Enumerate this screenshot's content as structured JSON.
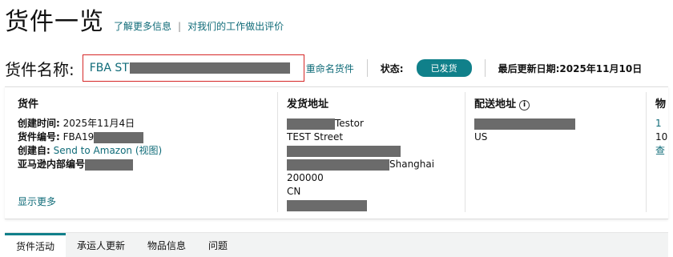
{
  "header": {
    "title": "货件一览",
    "link_learn": "了解更多信息",
    "separator": "|",
    "link_feedback": "对我们的工作做出评价"
  },
  "shipment": {
    "name_label": "货件名称:",
    "name_value": "FBA ST",
    "rename": "重命名货件",
    "status_label": "状态:",
    "status_value": "已发货",
    "updated_label": "最后更新日期:",
    "updated_value": "2025年11月10日"
  },
  "details": {
    "title": "货件",
    "created_label": "创建时间:",
    "created_value": "2025年11月4日",
    "number_label": "货件编号:",
    "number_value": "FBA19",
    "source_label": "创建自:",
    "source_value": "Send to Amazon (视图)",
    "internal_label": "亚马逊内部编号",
    "show_more": "显示更多"
  },
  "ship_from": {
    "title": "发货地址",
    "name_suffix": "Testor",
    "street": "TEST Street",
    "city": "Shanghai",
    "postal": "200000",
    "country": "CN"
  },
  "ship_to": {
    "title": "配送地址",
    "country": "US"
  },
  "fourth_col": {
    "title": "物",
    "line1": "1",
    "line2": "10",
    "line3": "查"
  },
  "tabs": [
    {
      "label": "货件活动"
    },
    {
      "label": "承运人更新"
    },
    {
      "label": "物品信息"
    },
    {
      "label": "问题"
    }
  ],
  "colors": {
    "accent": "#10808a",
    "link": "#0f6b78",
    "highlight_border": "#d62828"
  }
}
